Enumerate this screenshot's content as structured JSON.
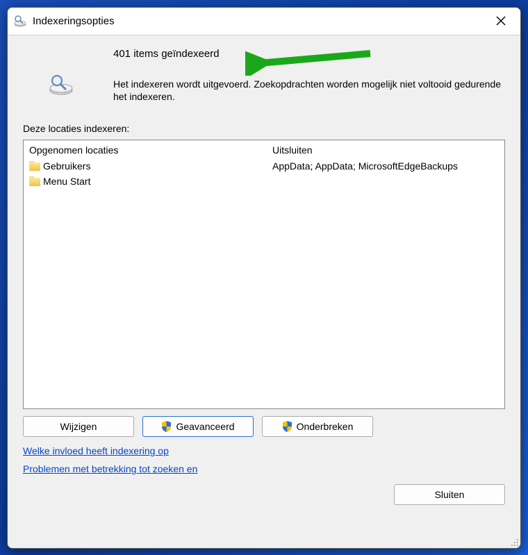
{
  "window": {
    "title": "Indexeringsopties"
  },
  "status": {
    "count_line": "401 items geïndexeerd",
    "message": "Het indexeren wordt uitgevoerd. Zoekopdrachten worden mogelijk niet voltooid gedurende het indexeren."
  },
  "section_label": "Deze locaties indexeren:",
  "columns": {
    "included_header": "Opgenomen locaties",
    "excluded_header": "Uitsluiten"
  },
  "included": [
    {
      "name": "Gebruikers"
    },
    {
      "name": "Menu Start"
    }
  ],
  "excluded": [
    "AppData; AppData; MicrosoftEdgeBackups",
    ""
  ],
  "buttons": {
    "modify": "Wijzigen",
    "advanced": "Geavanceerd",
    "pause": "Onderbreken",
    "close": "Sluiten"
  },
  "links": {
    "help": "Welke invloed heeft indexering op",
    "troubleshoot": "Problemen met betrekking tot zoeken en"
  }
}
